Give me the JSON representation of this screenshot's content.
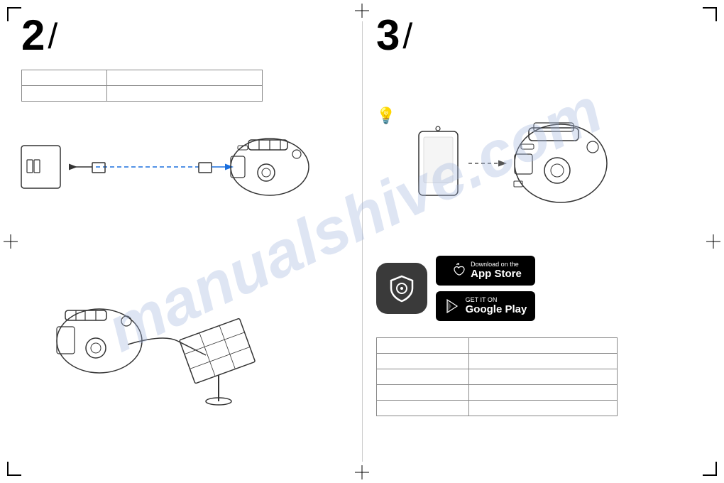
{
  "section2": {
    "number": "2",
    "slash": "/",
    "table": {
      "rows": [
        [
          "",
          ""
        ],
        [
          "",
          ""
        ]
      ]
    }
  },
  "section3": {
    "number": "3",
    "slash": "/",
    "appstore": {
      "download_label": "Download on the",
      "appstore_name": "App Store",
      "google_label": "GET IT ON",
      "google_name": "Google Play"
    },
    "bottomTable": {
      "rows": [
        [
          "",
          ""
        ],
        [
          "",
          ""
        ],
        [
          "",
          ""
        ],
        [
          "",
          ""
        ],
        [
          "",
          ""
        ]
      ]
    }
  },
  "watermark": "manualshive.com"
}
